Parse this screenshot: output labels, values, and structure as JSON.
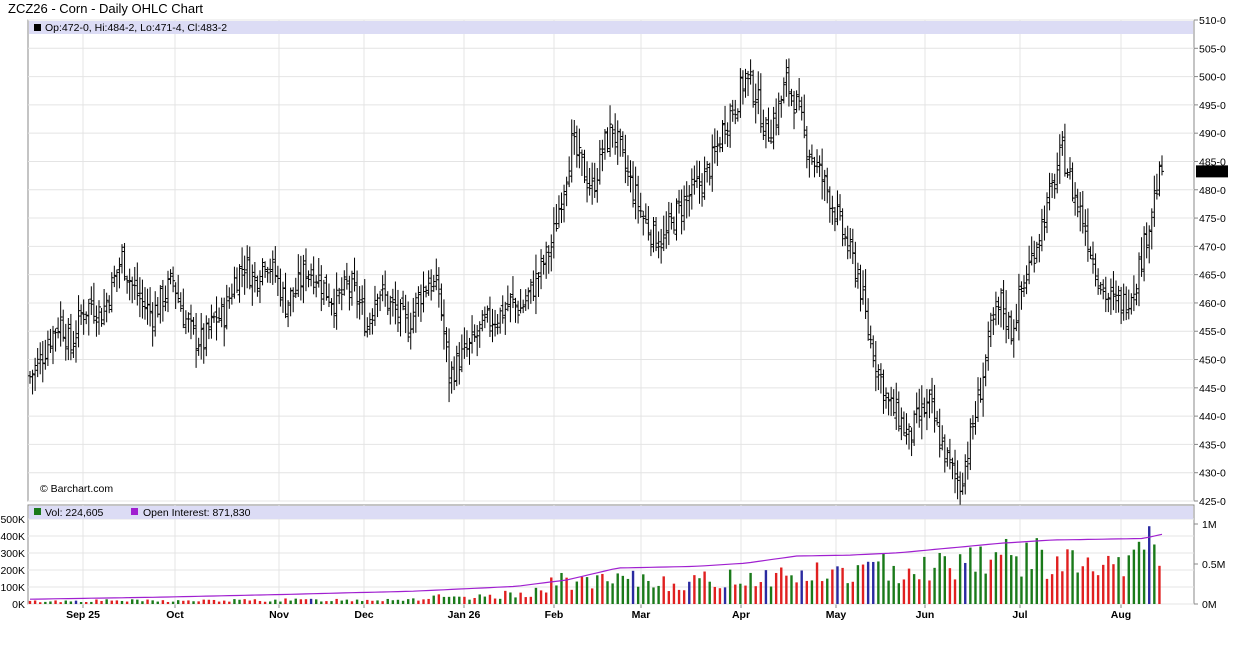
{
  "title": "ZCZ26 - Corn - Daily OHLC Chart",
  "credit": "© Barchart.com",
  "price_panel": {
    "info": "Op:472-0, Hi:484-2, Lo:471-4, Cl:483-2",
    "last_label": "483-2",
    "y_ticks": [
      "510-0",
      "505-0",
      "500-0",
      "495-0",
      "490-0",
      "485-0",
      "480-0",
      "475-0",
      "470-0",
      "465-0",
      "460-0",
      "455-0",
      "450-0",
      "445-0",
      "440-0",
      "435-0",
      "430-0",
      "425-0"
    ]
  },
  "volume_panel": {
    "vol_label": "Vol: 224,605",
    "oi_label": "Open Interest: 871,830",
    "left_ticks": [
      "500K",
      "400K",
      "300K",
      "200K",
      "100K",
      "0K"
    ],
    "right_ticks": [
      "1M",
      "0.5M",
      "0M"
    ]
  },
  "x_ticks": [
    "Sep 25",
    "Oct",
    "Nov",
    "Dec",
    "Jan 26",
    "Feb",
    "Mar",
    "Apr",
    "May",
    "Jun",
    "Jul",
    "Aug"
  ],
  "colors": {
    "up_volume": "#1a7a1a",
    "down_volume": "#e02020",
    "neutral_volume": "#2a2aa0",
    "open_interest": "#a020d0",
    "info_band": "#dcdcf5",
    "grid": "#e4e4e4"
  },
  "chart_data": {
    "type": "ohlc",
    "title": "ZCZ26 - Corn - Daily OHLC Chart",
    "ylim": [
      425,
      510
    ],
    "price_path": [
      [
        0,
        447
      ],
      [
        4,
        450
      ],
      [
        8,
        454
      ],
      [
        12,
        457
      ],
      [
        16,
        452
      ],
      [
        20,
        458
      ],
      [
        24,
        460
      ],
      [
        28,
        458
      ],
      [
        32,
        463
      ],
      [
        36,
        468
      ],
      [
        40,
        463
      ],
      [
        44,
        460
      ],
      [
        48,
        458
      ],
      [
        52,
        461
      ],
      [
        56,
        464
      ],
      [
        60,
        458
      ],
      [
        64,
        454
      ],
      [
        68,
        453
      ],
      [
        72,
        457
      ],
      [
        76,
        458
      ],
      [
        80,
        464
      ],
      [
        84,
        467
      ],
      [
        88,
        464
      ],
      [
        92,
        468
      ],
      [
        96,
        465
      ],
      [
        100,
        460
      ],
      [
        104,
        462
      ],
      [
        108,
        466
      ],
      [
        112,
        465
      ],
      [
        116,
        462
      ],
      [
        120,
        460
      ],
      [
        124,
        463
      ],
      [
        128,
        461
      ],
      [
        132,
        456
      ],
      [
        136,
        463
      ],
      [
        140,
        460
      ],
      [
        144,
        458
      ],
      [
        148,
        456
      ],
      [
        152,
        461
      ],
      [
        156,
        464
      ],
      [
        160,
        462
      ],
      [
        164,
        447
      ],
      [
        168,
        450
      ],
      [
        172,
        452
      ],
      [
        176,
        455
      ],
      [
        180,
        457
      ],
      [
        184,
        458
      ],
      [
        188,
        460
      ],
      [
        192,
        459
      ],
      [
        196,
        462
      ],
      [
        200,
        466
      ],
      [
        204,
        470
      ],
      [
        208,
        479
      ],
      [
        212,
        488
      ],
      [
        216,
        484
      ],
      [
        220,
        480
      ],
      [
        224,
        487
      ],
      [
        228,
        491
      ],
      [
        232,
        485
      ],
      [
        236,
        480
      ],
      [
        240,
        475
      ],
      [
        244,
        472
      ],
      [
        248,
        471
      ],
      [
        252,
        475
      ],
      [
        256,
        478
      ],
      [
        260,
        480
      ],
      [
        264,
        482
      ],
      [
        268,
        486
      ],
      [
        272,
        492
      ],
      [
        276,
        495
      ],
      [
        280,
        500
      ],
      [
        284,
        497
      ],
      [
        288,
        490
      ],
      [
        292,
        493
      ],
      [
        296,
        499
      ],
      [
        300,
        495
      ],
      [
        304,
        488
      ],
      [
        308,
        484
      ],
      [
        312,
        480
      ],
      [
        316,
        475
      ],
      [
        320,
        470
      ],
      [
        324,
        465
      ],
      [
        328,
        455
      ],
      [
        332,
        448
      ],
      [
        336,
        442
      ],
      [
        340,
        440
      ],
      [
        344,
        436
      ],
      [
        348,
        440
      ],
      [
        352,
        442
      ],
      [
        356,
        436
      ],
      [
        360,
        431
      ],
      [
        364,
        428
      ],
      [
        368,
        436
      ],
      [
        372,
        445
      ],
      [
        376,
        455
      ],
      [
        380,
        460
      ],
      [
        384,
        455
      ],
      [
        388,
        462
      ],
      [
        392,
        468
      ],
      [
        396,
        474
      ],
      [
        400,
        480
      ],
      [
        404,
        487
      ],
      [
        408,
        480
      ],
      [
        412,
        475
      ],
      [
        416,
        468
      ],
      [
        420,
        462
      ],
      [
        424,
        460
      ],
      [
        428,
        460
      ],
      [
        432,
        463
      ],
      [
        436,
        470
      ],
      [
        440,
        479
      ],
      [
        443,
        483.25
      ]
    ],
    "volume": {
      "ylim": [
        0,
        500000
      ],
      "series": [
        {
          "name": "Vol",
          "x_end": 443,
          "last": 224605,
          "path": [
            [
              0,
              15000
            ],
            [
              30,
              20000
            ],
            [
              60,
              18000
            ],
            [
              90,
              22000
            ],
            [
              120,
              24000
            ],
            [
              150,
              28000
            ],
            [
              160,
              40000
            ],
            [
              170,
              30000
            ],
            [
              190,
              60000
            ],
            [
              200,
              80000
            ],
            [
              210,
              150000
            ],
            [
              220,
              120000
            ],
            [
              240,
              140000
            ],
            [
              260,
              125000
            ],
            [
              280,
              160000
            ],
            [
              300,
              170000
            ],
            [
              320,
              180000
            ],
            [
              340,
              220000
            ],
            [
              360,
              230000
            ],
            [
              370,
              300000
            ],
            [
              380,
              270000
            ],
            [
              390,
              280000
            ],
            [
              400,
              250000
            ],
            [
              410,
              230000
            ],
            [
              420,
              200000
            ],
            [
              430,
              210000
            ],
            [
              438,
              420000
            ],
            [
              441,
              300000
            ],
            [
              443,
              224605
            ]
          ]
        },
        {
          "name": "Open Interest",
          "right_axis_max": 1000000,
          "last": 871830,
          "path": [
            [
              0,
              60000
            ],
            [
              50,
              85000
            ],
            [
              100,
              120000
            ],
            [
              150,
              160000
            ],
            [
              190,
              220000
            ],
            [
              210,
              300000
            ],
            [
              230,
              450000
            ],
            [
              260,
              470000
            ],
            [
              280,
              510000
            ],
            [
              300,
              600000
            ],
            [
              320,
              610000
            ],
            [
              340,
              640000
            ],
            [
              360,
              700000
            ],
            [
              380,
              760000
            ],
            [
              400,
              800000
            ],
            [
              420,
              810000
            ],
            [
              436,
              820000
            ],
            [
              443,
              871830
            ]
          ]
        }
      ]
    }
  }
}
